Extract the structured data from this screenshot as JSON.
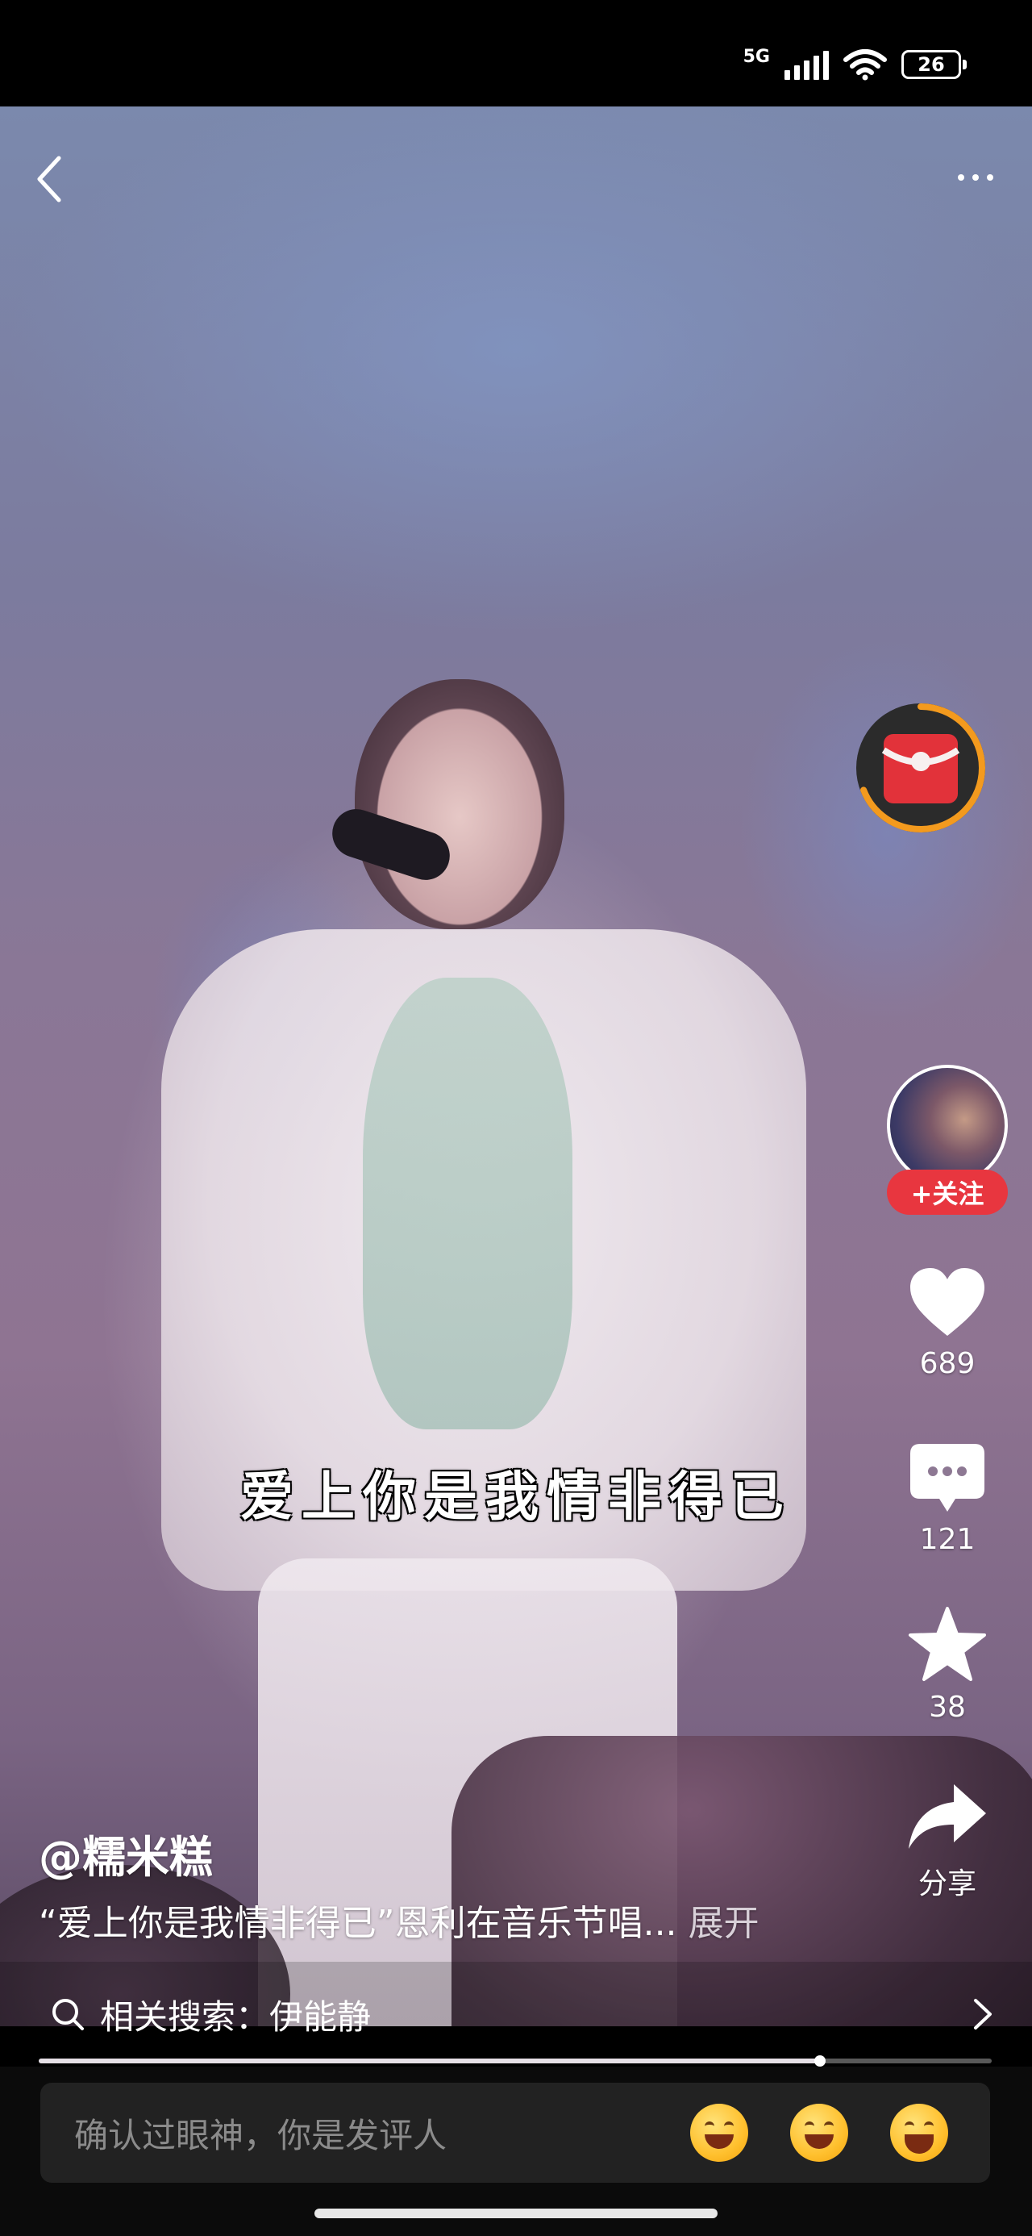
{
  "status_bar": {
    "network": "5G",
    "battery": "26"
  },
  "video": {
    "subtitle": "爱上你是我情非得已",
    "progress": 0.82
  },
  "rail": {
    "follow_label": "+关注",
    "likes": "689",
    "comments": "121",
    "favorites": "38",
    "share_label": "分享"
  },
  "caption": {
    "author": "@糯米糕",
    "description": "“爱上你是我情非得已”恩利在音乐节唱...",
    "expand_label": "展开"
  },
  "related_search": {
    "label": "相关搜索：伊能静"
  },
  "comment_bar": {
    "placeholder": "确认过眼神，你是发评人"
  },
  "icons": [
    "back-icon",
    "more-icon",
    "red-packet-icon",
    "heart-icon",
    "comment-icon",
    "star-icon",
    "share-icon",
    "search-icon",
    "chevron-right-icon",
    "laugh-cry-emoji",
    "grin-emoji",
    "big-grin-emoji"
  ],
  "colors": {
    "follow_red": "#e8363f",
    "packet_ring": "#f39a1e"
  }
}
